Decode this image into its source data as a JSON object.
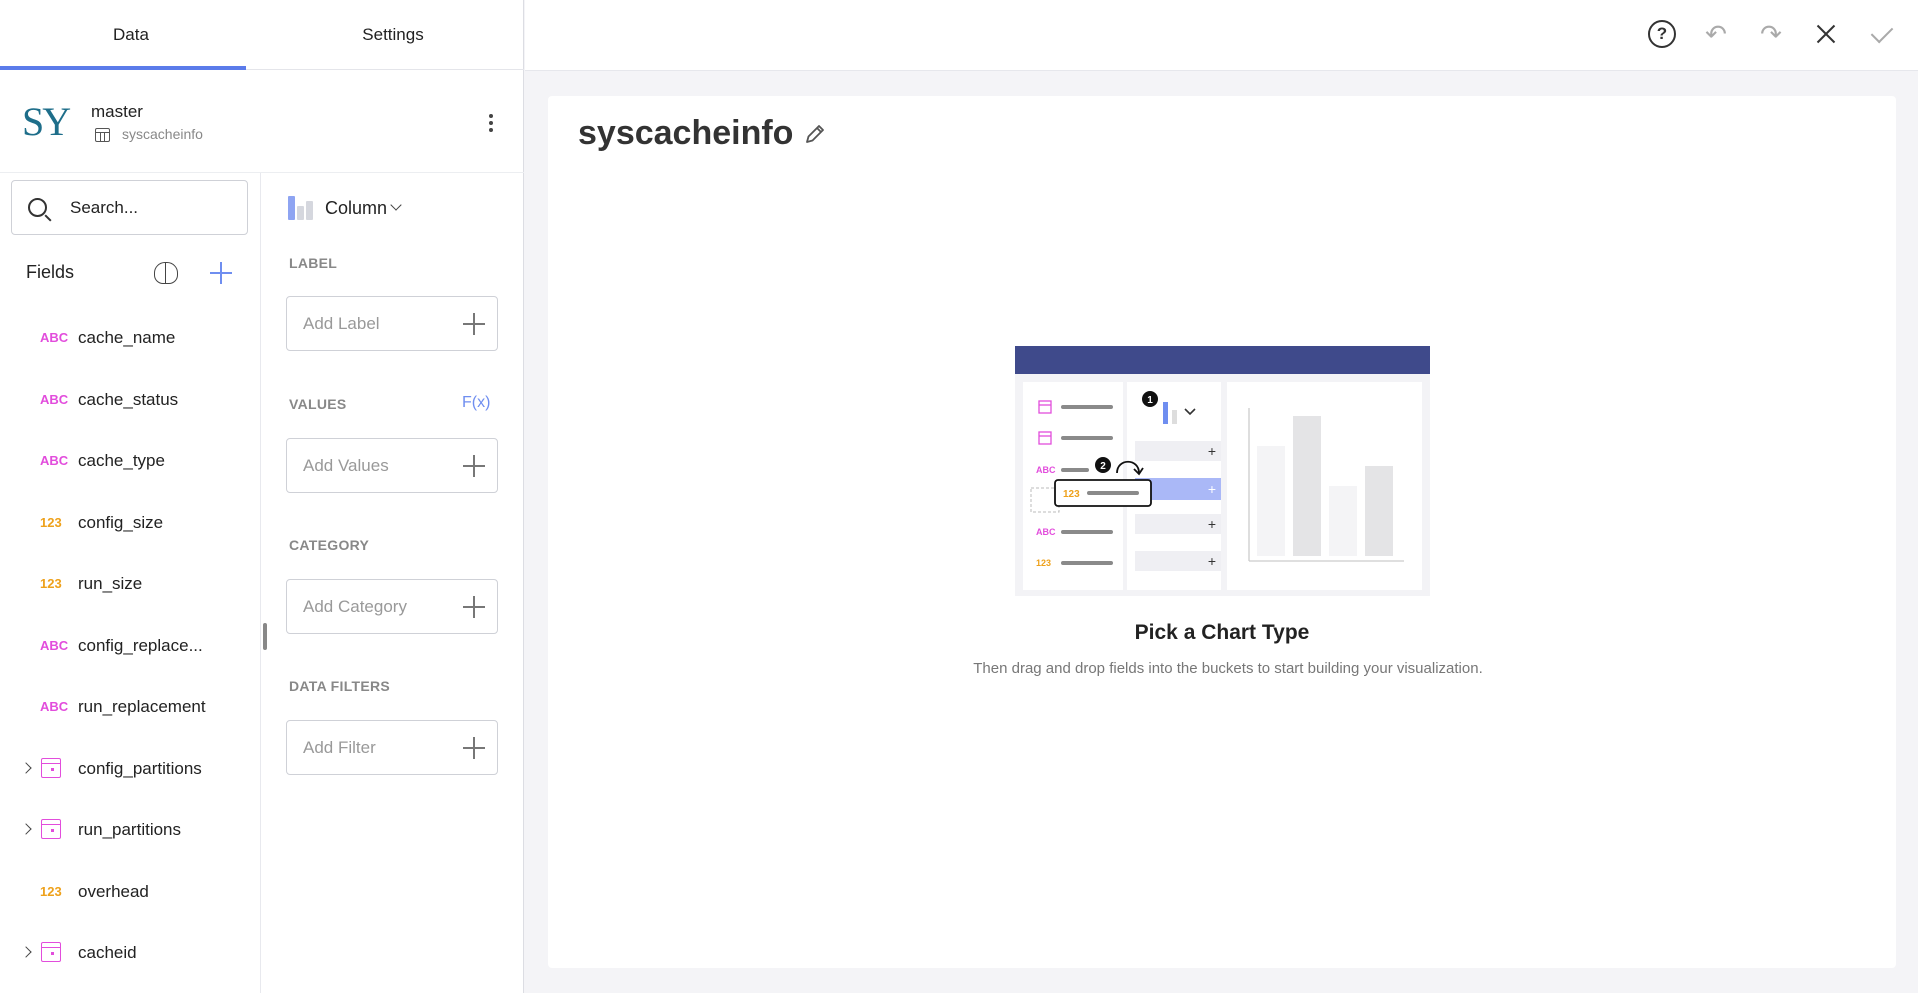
{
  "tabs": [
    {
      "label": "Data"
    },
    {
      "label": "Settings"
    }
  ],
  "datasource": {
    "logo": "SY",
    "name": "master",
    "table": "syscacheinfo"
  },
  "search": {
    "placeholder": "Search..."
  },
  "fields_header": "Fields",
  "fields": [
    {
      "type": "ABC",
      "name": "cache_name",
      "kind": "text"
    },
    {
      "type": "ABC",
      "name": "cache_status",
      "kind": "text"
    },
    {
      "type": "ABC",
      "name": "cache_type",
      "kind": "text"
    },
    {
      "type": "123",
      "name": "config_size",
      "kind": "number"
    },
    {
      "type": "123",
      "name": "run_size",
      "kind": "number"
    },
    {
      "type": "ABC",
      "name": "config_replace...",
      "kind": "text"
    },
    {
      "type": "ABC",
      "name": "run_replacement",
      "kind": "text"
    },
    {
      "type": "",
      "name": "config_partitions",
      "kind": "date"
    },
    {
      "type": "",
      "name": "run_partitions",
      "kind": "date"
    },
    {
      "type": "123",
      "name": "overhead",
      "kind": "number"
    },
    {
      "type": "",
      "name": "cacheid",
      "kind": "date"
    }
  ],
  "chart_type": {
    "label": "Column"
  },
  "buckets": {
    "label": {
      "title": "LABEL",
      "placeholder": "Add Label"
    },
    "values": {
      "title": "VALUES",
      "placeholder": "Add Values",
      "fx": "F(x)"
    },
    "category": {
      "title": "CATEGORY",
      "placeholder": "Add Category"
    },
    "filters": {
      "title": "DATA FILTERS",
      "placeholder": "Add Filter"
    }
  },
  "toolbar": {
    "help": "?"
  },
  "main": {
    "title": "syscacheinfo",
    "empty_title": "Pick a Chart Type",
    "empty_subtitle": "Then drag and drop fields into the buckets to start building your visualization."
  },
  "illustration": {
    "badges": [
      "1",
      "2"
    ],
    "type_labels": [
      "ABC",
      "123",
      "ABC",
      "123"
    ]
  },
  "colors": {
    "accent": "#5b7bea",
    "text_type": "#e24ddc",
    "number_type": "#eea11b",
    "illustration_header": "#3f4a8b"
  }
}
